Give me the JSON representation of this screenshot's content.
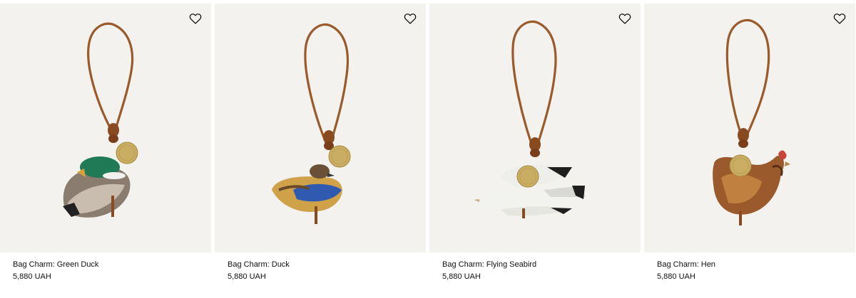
{
  "products": [
    {
      "name": "Bag Charm: Green Duck",
      "price": "5,880 UAH",
      "wishlist_icon": "heart-outline-icon"
    },
    {
      "name": "Bag Charm: Duck",
      "price": "5,880 UAH",
      "wishlist_icon": "heart-outline-icon"
    },
    {
      "name": "Bag Charm: Flying Seabird",
      "price": "5,880 UAH",
      "wishlist_icon": "heart-outline-icon"
    },
    {
      "name": "Bag Charm: Hen",
      "price": "5,880 UAH",
      "wishlist_icon": "heart-outline-icon"
    }
  ],
  "colors": {
    "image_background": "#f3f2ef",
    "leather_cord": "#9a5a2a",
    "brass_tag": "#c9ad62"
  }
}
